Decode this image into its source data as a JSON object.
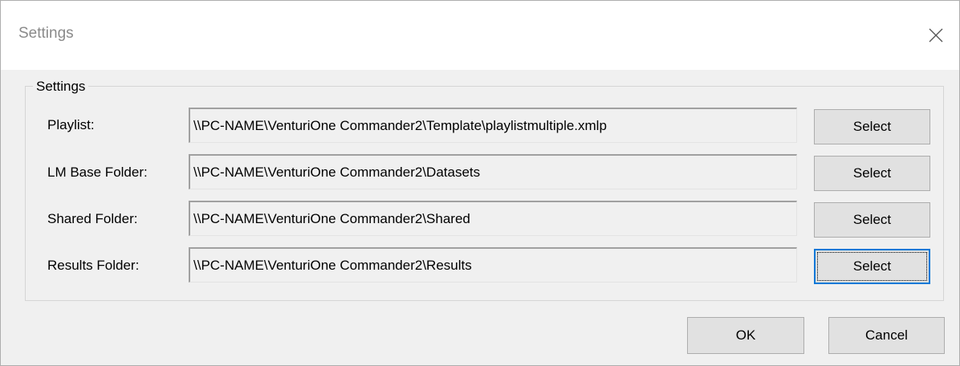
{
  "window": {
    "title": "Settings"
  },
  "group": {
    "label": "Settings"
  },
  "rows": [
    {
      "label": "Playlist:",
      "value": "\\\\PC-NAME\\VenturiOne Commander2\\Template\\playlistmultiple.xmlp",
      "button": "Select"
    },
    {
      "label": "LM Base Folder:",
      "value": "\\\\PC-NAME\\VenturiOne Commander2\\Datasets",
      "button": "Select"
    },
    {
      "label": "Shared Folder:",
      "value": "\\\\PC-NAME\\VenturiOne Commander2\\Shared",
      "button": "Select"
    },
    {
      "label": "Results Folder:",
      "value": "\\\\PC-NAME\\VenturiOne Commander2\\Results",
      "button": "Select"
    }
  ],
  "footer": {
    "ok_label": "OK",
    "cancel_label": "Cancel"
  },
  "icons": {
    "close": "close-icon"
  },
  "colors": {
    "focus_accent": "#0078d7",
    "dialog_background": "#f0f0f0",
    "button_face": "#e1e1e1"
  }
}
